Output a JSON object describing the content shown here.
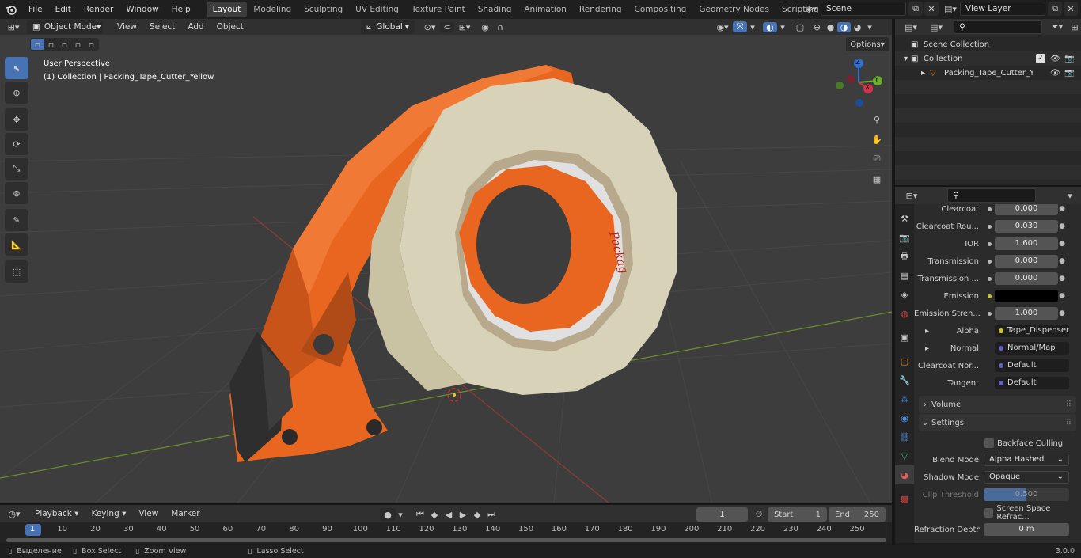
{
  "top_menu": {
    "items": [
      "File",
      "Edit",
      "Render",
      "Window",
      "Help"
    ],
    "workspaces": [
      "Layout",
      "Modeling",
      "Sculpting",
      "UV Editing",
      "Texture Paint",
      "Shading",
      "Animation",
      "Rendering",
      "Compositing",
      "Geometry Nodes",
      "Scripting"
    ],
    "active_workspace": "Layout",
    "add_tab": "+",
    "scene": "Scene",
    "view_layer": "View Layer"
  },
  "viewport_header": {
    "mode": "Object Mode",
    "menus": [
      "View",
      "Select",
      "Add",
      "Object"
    ],
    "transform_orientation": "Global",
    "options_label": "Options"
  },
  "viewport": {
    "perspective_label": "User Perspective",
    "collection_label": "(1) Collection | Packing_Tape_Cutter_Yellow",
    "tape_print": "Packag",
    "gizmo": {
      "z": "Z",
      "y": "Y",
      "x": "X"
    }
  },
  "toolbar_tools": [
    "select-box",
    "cursor",
    "move",
    "rotate",
    "scale",
    "transform",
    "annotate",
    "measure",
    "add-cube"
  ],
  "outliner": {
    "search_placeholder": "",
    "scene_collection": "Scene Collection",
    "collection": "Collection",
    "object": "Packing_Tape_Cutter_Yel"
  },
  "properties": {
    "rows": [
      {
        "label": "Clearcoat",
        "value": "0.000"
      },
      {
        "label": "Clearcoat Rou...",
        "value": "0.030"
      },
      {
        "label": "IOR",
        "value": "1.600"
      },
      {
        "label": "Transmission",
        "value": "0.000"
      },
      {
        "label": "Transmission ...",
        "value": "0.000"
      },
      {
        "label": "Emission",
        "value": ""
      },
      {
        "label": "Emission Stren...",
        "value": "1.000"
      }
    ],
    "links": [
      {
        "label": "Alpha",
        "value": "Tape_Dispenser_s..."
      },
      {
        "label": "Normal",
        "value": "Normal/Map"
      },
      {
        "label": "Clearcoat Nor...",
        "value": "Default"
      },
      {
        "label": "Tangent",
        "value": "Default"
      }
    ],
    "volume_label": "Volume",
    "settings_label": "Settings",
    "backface_culling": "Backface Culling",
    "blend_mode_label": "Blend Mode",
    "blend_mode": "Alpha Hashed",
    "shadow_mode_label": "Shadow Mode",
    "shadow_mode": "Opaque",
    "clip_threshold_label": "Clip Threshold",
    "clip_threshold": "0.500",
    "ssr_label": "Screen Space Refrac...",
    "refraction_depth_label": "Refraction Depth",
    "refraction_depth": "0 m",
    "emission_color": "#000000"
  },
  "timeline": {
    "menus": [
      "Playback",
      "Keying",
      "View",
      "Marker"
    ],
    "current_frame": "1",
    "start_label": "Start",
    "start": "1",
    "end_label": "End",
    "end": "250",
    "ruler": [
      "1",
      "10",
      "20",
      "30",
      "40",
      "50",
      "60",
      "70",
      "80",
      "90",
      "100",
      "110",
      "120",
      "130",
      "140",
      "150",
      "160",
      "170",
      "180",
      "190",
      "200",
      "210",
      "220",
      "230",
      "240",
      "250"
    ]
  },
  "statusbar": {
    "select": "Выделение",
    "box_select": "Box Select",
    "zoom_view": "Zoom View",
    "lasso_select": "Lasso Select",
    "version": "3.0.0"
  },
  "colors": {
    "accent": "#4772b3",
    "orange": "#e8661f",
    "tape": "#d8d3b8"
  }
}
